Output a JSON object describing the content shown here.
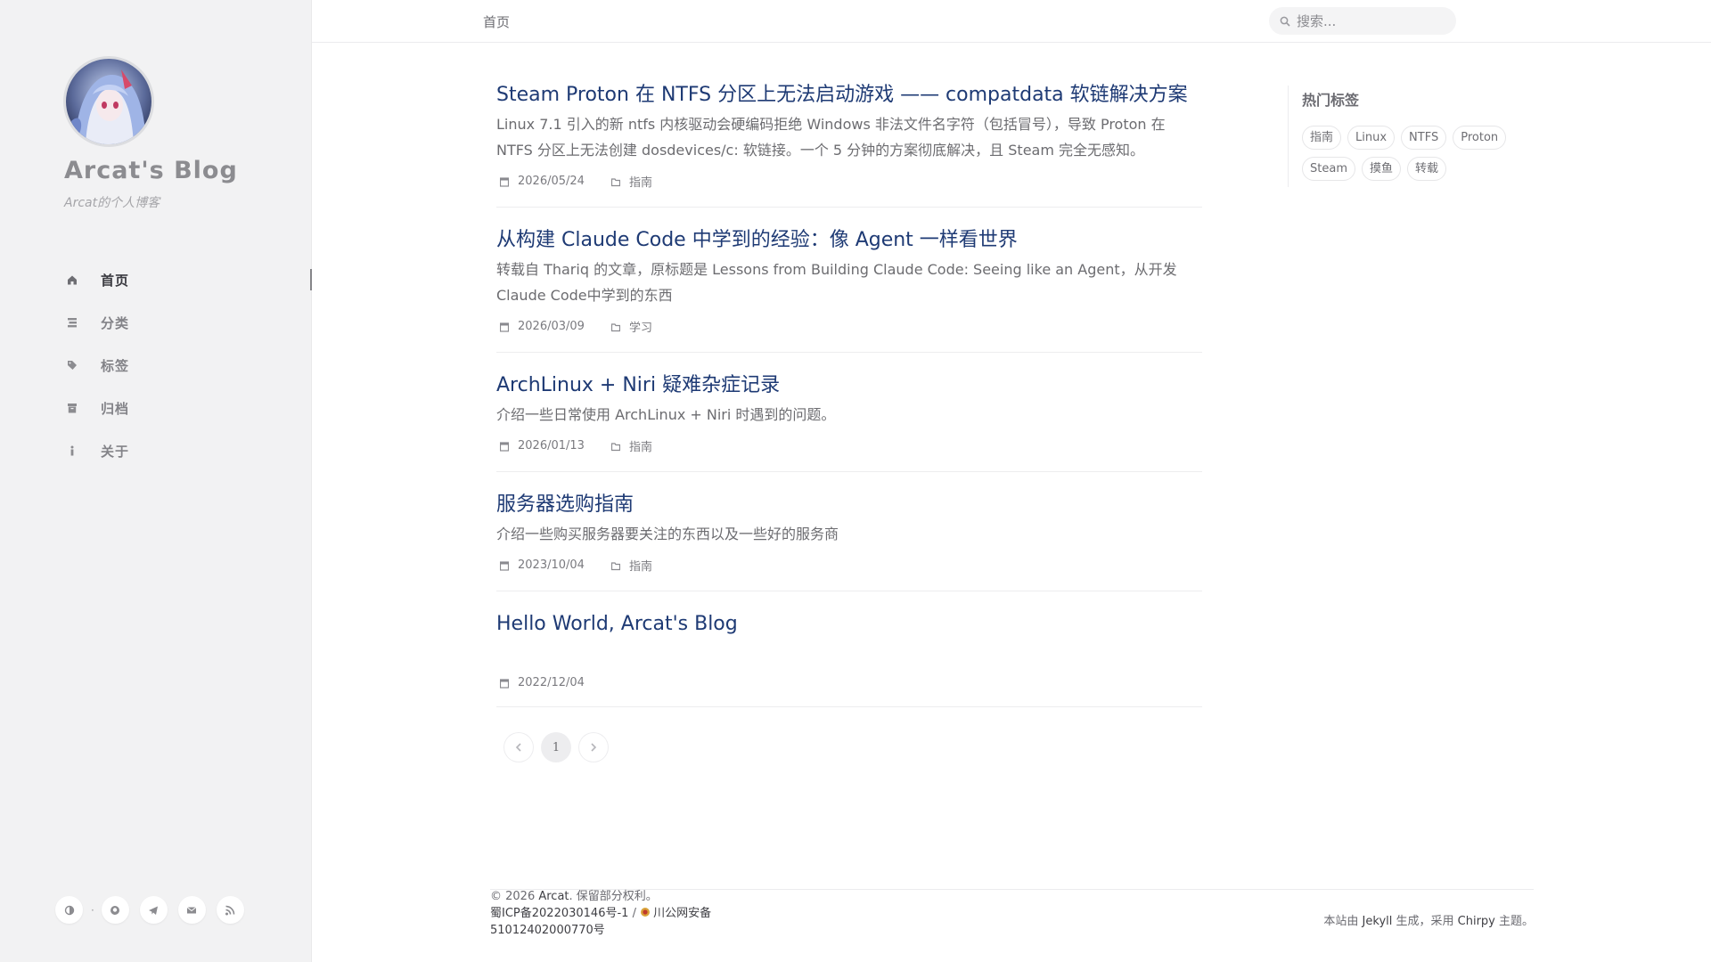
{
  "sidebar": {
    "site_title": "Arcat's Blog",
    "site_subtitle": "Arcat的个人博客",
    "nav": [
      {
        "label": "首页",
        "icon": "home-icon",
        "active": true
      },
      {
        "label": "分类",
        "icon": "stream-icon"
      },
      {
        "label": "标签",
        "icon": "tags-icon"
      },
      {
        "label": "归档",
        "icon": "archive-icon"
      },
      {
        "label": "关于",
        "icon": "info-icon"
      }
    ],
    "social": [
      "theme-toggle-icon",
      "github-icon",
      "telegram-icon",
      "email-icon",
      "rss-icon"
    ]
  },
  "topbar": {
    "breadcrumb": "首页",
    "search_placeholder": "搜索..."
  },
  "posts": [
    {
      "title": "Steam Proton 在 NTFS 分区上无法启动游戏 —— compatdata 软链解决方案",
      "excerpt": "Linux 7.1 引入的新 ntfs 内核驱动会硬编码拒绝 Windows 非法文件名字符（包括冒号），导致 Proton 在 NTFS 分区上无法创建 dosdevices/c: 软链接。一个 5 分钟的方案彻底解决，且 Steam 完全无感知。",
      "date": "2026/05/24",
      "category": "指南"
    },
    {
      "title": "从构建 Claude Code 中学到的经验：像 Agent 一样看世界",
      "excerpt": "转载自 Thariq 的文章，原标题是 Lessons from Building Claude Code: Seeing like an Agent，从开发 Claude Code中学到的东西",
      "date": "2026/03/09",
      "category": "学习"
    },
    {
      "title": "ArchLinux + Niri 疑难杂症记录",
      "excerpt": "介绍一些日常使用 ArchLinux + Niri 时遇到的问题。",
      "date": "2026/01/13",
      "category": "指南"
    },
    {
      "title": "服务器选购指南",
      "excerpt": "介绍一些购买服务器要关注的东西以及一些好的服务商",
      "date": "2023/10/04",
      "category": "指南"
    },
    {
      "title": "Hello World, Arcat's Blog",
      "excerpt": "",
      "date": "2022/12/04",
      "category": ""
    }
  ],
  "pagination": {
    "current": "1"
  },
  "panel": {
    "title": "热门标签",
    "tags": [
      "指南",
      "Linux",
      "NTFS",
      "Proton",
      "Steam",
      "摸鱼",
      "转载"
    ]
  },
  "footer": {
    "copyright_prefix": "© 2026 ",
    "author": "Arcat",
    "copyright_suffix": ". 保留部分权利。",
    "icp": "蜀ICP备2022030146号-1",
    "separator": " / ",
    "police_line1": "川公网安备",
    "police_line2": "51012402000770号",
    "built_prefix": "本站由 ",
    "jekyll": "Jekyll",
    "built_mid": " 生成，采用 ",
    "chirpy": "Chirpy",
    "built_suffix": " 主题。"
  },
  "colors": {
    "sidebar_bg": "#f2f2f3",
    "title_link": "#1e3a74",
    "muted_text": "#6c6c70"
  }
}
